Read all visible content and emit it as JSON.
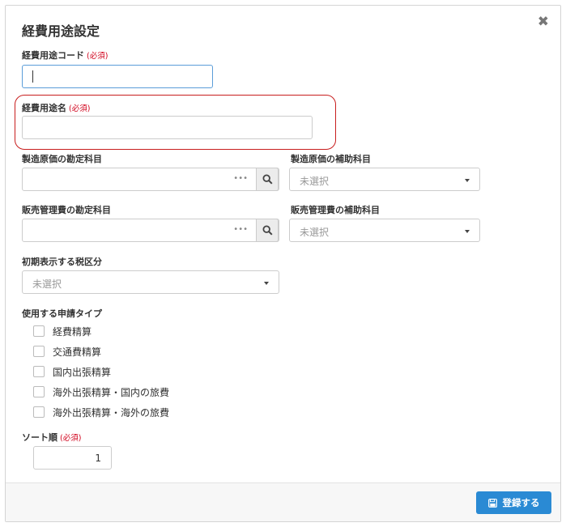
{
  "dialog": {
    "title": "経費用途設定",
    "close_symbol": "✖"
  },
  "fields": {
    "code": {
      "label": "経費用途コード",
      "required": "(必須)",
      "value": ""
    },
    "name": {
      "label": "経費用途名",
      "required": "(必須)",
      "value": ""
    },
    "mfg_account": {
      "label": "製造原価の勘定科目",
      "value": "",
      "more_symbol": "•••"
    },
    "mfg_sub_account": {
      "label": "製造原価の補助科目",
      "placeholder": "未選択"
    },
    "sga_account": {
      "label": "販売管理費の勘定科目",
      "value": "",
      "more_symbol": "•••"
    },
    "sga_sub_account": {
      "label": "販売管理費の補助科目",
      "placeholder": "未選択"
    },
    "tax_category": {
      "label": "初期表示する税区分",
      "placeholder": "未選択"
    },
    "application_types": {
      "label": "使用する申請タイプ",
      "options": [
        "経費精算",
        "交通費精算",
        "国内出張精算",
        "海外出張精算・国内の旅費",
        "海外出張精算・海外の旅費"
      ]
    },
    "sort_order": {
      "label": "ソート順",
      "required": "(必須)",
      "value": "1"
    }
  },
  "footer": {
    "submit_label": "登録する"
  },
  "colors": {
    "accent": "#2a8ad4",
    "required": "#d0021b",
    "highlight": "#c81e1e"
  },
  "icons": {
    "close": "close-icon",
    "search": "search-icon",
    "save": "floppy-disk-icon"
  }
}
